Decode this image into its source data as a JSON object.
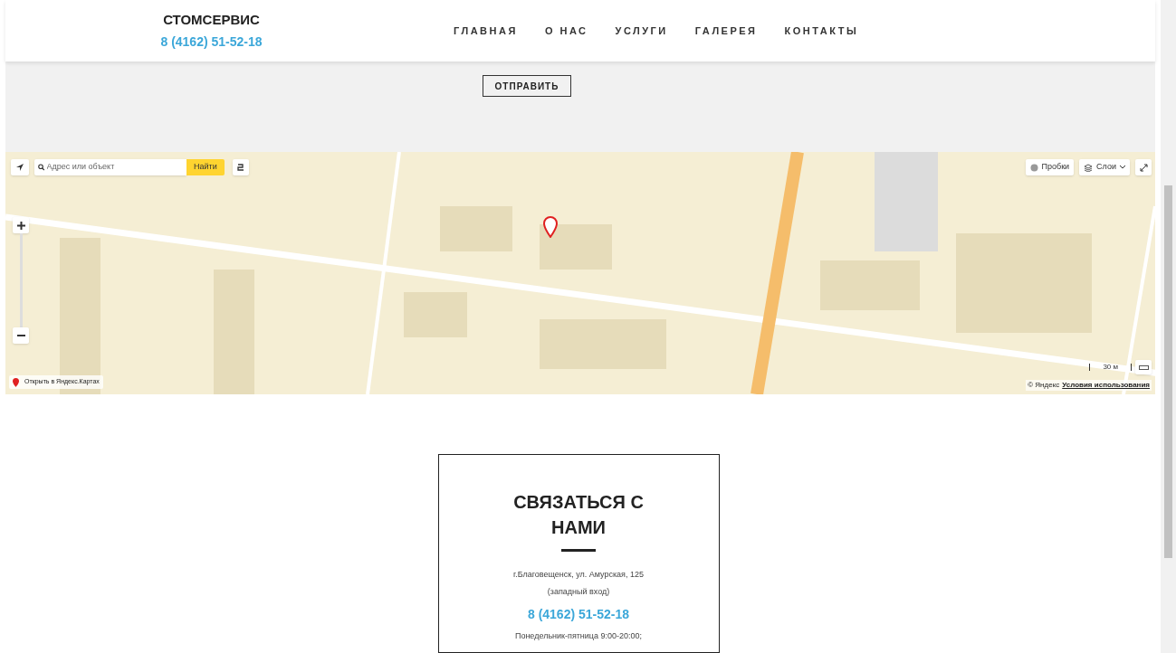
{
  "header": {
    "brand": "СТОМСЕРВИС",
    "phone": "8 (4162) 51-52-18",
    "nav": [
      {
        "label": "ГЛАВНАЯ"
      },
      {
        "label": "О НАС"
      },
      {
        "label": "УСЛУГИ"
      },
      {
        "label": "ГАЛЕРЕЯ"
      },
      {
        "label": "КОНТАКТЫ"
      }
    ]
  },
  "form": {
    "submit": "ОТПРАВИТЬ"
  },
  "map": {
    "search_placeholder": "Адрес или объект",
    "search_button": "Найти",
    "traffic_button": "Пробки",
    "layers_button": "Слои",
    "open_link": "Открыть в Яндекс.Картах",
    "scale": "30 м",
    "copyright": "© Яндекс",
    "terms_link": "Условия использования"
  },
  "contact": {
    "title": "СВЯЗАТЬСЯ С НАМИ",
    "address": "г.Благовещенск, ул. Амурская, 125",
    "entrance": "(западный вход)",
    "phone": "8 (4162) 51-52-18",
    "hours": "Понедельник-пятница 9:00-20:00;"
  }
}
